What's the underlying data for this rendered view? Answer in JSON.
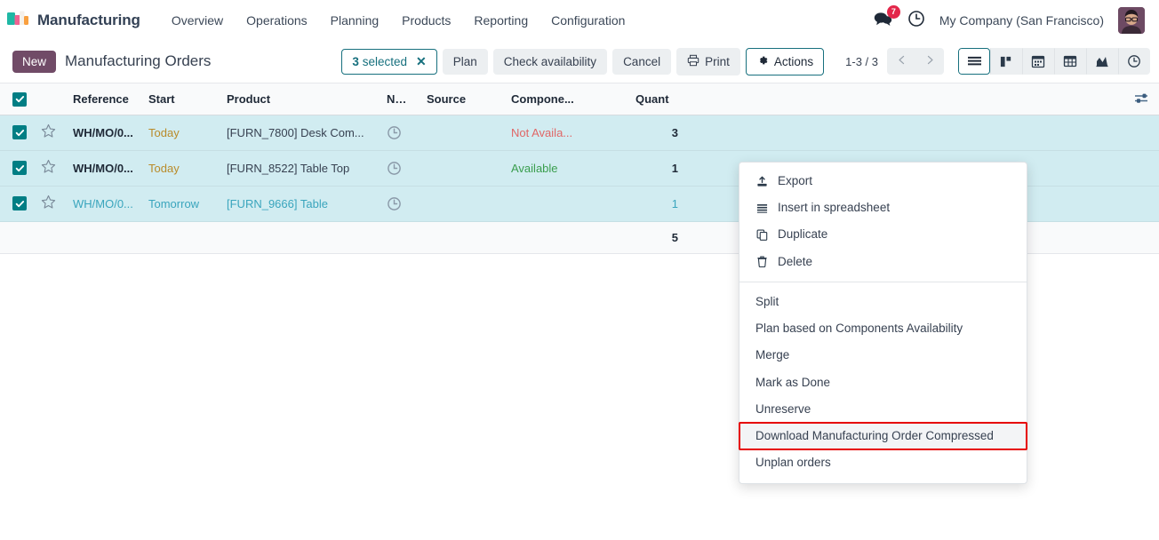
{
  "navbar": {
    "brand": "Manufacturing",
    "menu": [
      {
        "label": "Overview"
      },
      {
        "label": "Operations"
      },
      {
        "label": "Planning"
      },
      {
        "label": "Products"
      },
      {
        "label": "Reporting"
      },
      {
        "label": "Configuration"
      }
    ],
    "messages_badge": "7",
    "company": "My Company (San Francisco)"
  },
  "control_panel": {
    "new_label": "New",
    "title": "Manufacturing Orders",
    "selection": {
      "count": "3",
      "suffix": "selected"
    },
    "buttons": [
      {
        "label": "Plan",
        "name": "plan-button"
      },
      {
        "label": "Check availability",
        "name": "check-availability-button"
      },
      {
        "label": "Cancel",
        "name": "cancel-button"
      },
      {
        "label": "Print",
        "name": "print-button",
        "icon": "printer-icon"
      },
      {
        "label": "Actions",
        "name": "actions-button",
        "icon": "gear-icon",
        "active": true
      }
    ],
    "pager": "1-3 / 3",
    "views": [
      {
        "name": "list-view-icon",
        "active": true
      },
      {
        "name": "kanban-view-icon",
        "active": false
      },
      {
        "name": "calendar-view-icon",
        "active": false
      },
      {
        "name": "pivot-view-icon",
        "active": false
      },
      {
        "name": "graph-view-icon",
        "active": false
      },
      {
        "name": "activity-view-icon",
        "active": false
      }
    ]
  },
  "table": {
    "columns": [
      {
        "label": "Reference"
      },
      {
        "label": "Start"
      },
      {
        "label": "Product"
      },
      {
        "label": "Next Acti..."
      },
      {
        "label": "Source"
      },
      {
        "label": "Compone..."
      },
      {
        "label": "Quant"
      }
    ],
    "rows": [
      {
        "selected": true,
        "reference": "WH/MO/0...",
        "start": "Today",
        "product": "[FURN_7800] Desk Com...",
        "source": "",
        "components": "Not Availa...",
        "components_state": "danger",
        "quantity": "3",
        "draft": false
      },
      {
        "selected": true,
        "reference": "WH/MO/0...",
        "start": "Today",
        "product": "[FURN_8522] Table Top",
        "source": "",
        "components": "Available",
        "components_state": "success",
        "quantity": "1",
        "draft": false
      },
      {
        "selected": true,
        "reference": "WH/MO/0...",
        "start": "Tomorrow",
        "product": "[FURN_9666] Table",
        "source": "",
        "components": "",
        "components_state": "none",
        "quantity": "1",
        "draft": true
      }
    ],
    "total_quantity": "5"
  },
  "actions_menu": {
    "group_1": [
      {
        "label": "Export",
        "icon": "export-icon"
      },
      {
        "label": "Insert in spreadsheet",
        "icon": "spreadsheet-icon"
      },
      {
        "label": "Duplicate",
        "icon": "duplicate-icon"
      },
      {
        "label": "Delete",
        "icon": "trash-icon"
      }
    ],
    "group_2": [
      {
        "label": "Split",
        "highlighted": false
      },
      {
        "label": "Plan based on Components Availability",
        "highlighted": false
      },
      {
        "label": "Merge",
        "highlighted": false
      },
      {
        "label": "Mark as Done",
        "highlighted": false
      },
      {
        "label": "Unreserve",
        "highlighted": false
      },
      {
        "label": "Download Manufacturing Order Compressed",
        "highlighted": true
      },
      {
        "label": "Unplan orders",
        "highlighted": false
      }
    ]
  },
  "colors": {
    "brand_purple": "#714b67",
    "accent_teal": "#017e84",
    "selected_row": "#d1ecf1",
    "badge_red": "#e3264a",
    "highlight_red": "#e60000"
  }
}
